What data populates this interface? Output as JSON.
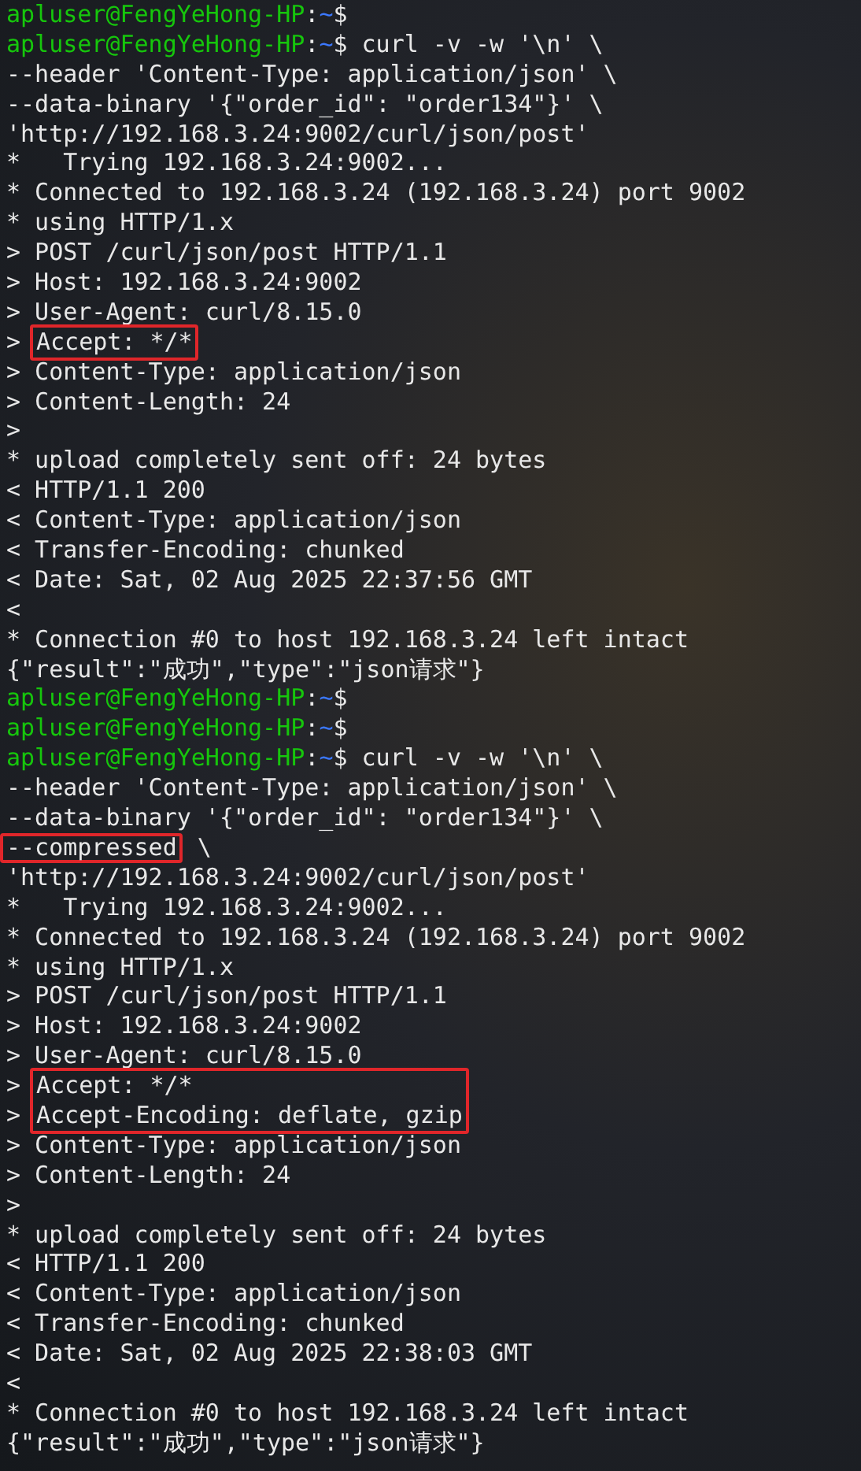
{
  "terminal": {
    "items": [
      {
        "kind": "line",
        "segments": [
          {
            "kind": "user",
            "text": "apluser@FengYeHong-HP"
          },
          {
            "kind": "text",
            "text": ":"
          },
          {
            "kind": "path",
            "text": "~"
          },
          {
            "kind": "text",
            "text": "$"
          }
        ]
      },
      {
        "kind": "line",
        "segments": [
          {
            "kind": "user",
            "text": "apluser@FengYeHong-HP"
          },
          {
            "kind": "text",
            "text": ":"
          },
          {
            "kind": "path",
            "text": "~"
          },
          {
            "kind": "text",
            "text": "$ curl -v -w '\\n' \\"
          }
        ]
      },
      {
        "kind": "line",
        "segments": [
          {
            "kind": "text",
            "text": "--header 'Content-Type: application/json' \\"
          }
        ]
      },
      {
        "kind": "line",
        "segments": [
          {
            "kind": "text",
            "text": "--data-binary '{\"order_id\": \"order134\"}' \\"
          }
        ]
      },
      {
        "kind": "line",
        "segments": [
          {
            "kind": "text",
            "text": "'http://192.168.3.24:9002/curl/json/post'"
          }
        ]
      },
      {
        "kind": "line",
        "segments": [
          {
            "kind": "text",
            "text": "*   Trying 192.168.3.24:9002..."
          }
        ]
      },
      {
        "kind": "line",
        "segments": [
          {
            "kind": "text",
            "text": "* Connected to 192.168.3.24 (192.168.3.24) port 9002"
          }
        ]
      },
      {
        "kind": "line",
        "segments": [
          {
            "kind": "text",
            "text": "* using HTTP/1.x"
          }
        ]
      },
      {
        "kind": "line",
        "segments": [
          {
            "kind": "text",
            "text": "> POST /curl/json/post HTTP/1.1"
          }
        ]
      },
      {
        "kind": "line",
        "segments": [
          {
            "kind": "text",
            "text": "> Host: 192.168.3.24:9002"
          }
        ]
      },
      {
        "kind": "line",
        "segments": [
          {
            "kind": "text",
            "text": "> User-Agent: curl/8.15.0"
          }
        ]
      },
      {
        "kind": "boxed-group",
        "rows": [
          {
            "prefix": ">",
            "text": "Accept: */*"
          }
        ]
      },
      {
        "kind": "line",
        "segments": [
          {
            "kind": "text",
            "text": "> Content-Type: application/json"
          }
        ]
      },
      {
        "kind": "line",
        "segments": [
          {
            "kind": "text",
            "text": "> Content-Length: 24"
          }
        ]
      },
      {
        "kind": "line",
        "segments": [
          {
            "kind": "text",
            "text": ">"
          }
        ]
      },
      {
        "kind": "line",
        "segments": [
          {
            "kind": "text",
            "text": "* upload completely sent off: 24 bytes"
          }
        ]
      },
      {
        "kind": "line",
        "segments": [
          {
            "kind": "text",
            "text": "< HTTP/1.1 200"
          }
        ]
      },
      {
        "kind": "line",
        "segments": [
          {
            "kind": "text",
            "text": "< Content-Type: application/json"
          }
        ]
      },
      {
        "kind": "line",
        "segments": [
          {
            "kind": "text",
            "text": "< Transfer-Encoding: chunked"
          }
        ]
      },
      {
        "kind": "line",
        "segments": [
          {
            "kind": "text",
            "text": "< Date: Sat, 02 Aug 2025 22:37:56 GMT"
          }
        ]
      },
      {
        "kind": "line",
        "segments": [
          {
            "kind": "text",
            "text": "<"
          }
        ]
      },
      {
        "kind": "line",
        "segments": [
          {
            "kind": "text",
            "text": "* Connection #0 to host 192.168.3.24 left intact"
          }
        ]
      },
      {
        "kind": "line",
        "segments": [
          {
            "kind": "text",
            "text": "{\"result\":\"成功\",\"type\":\"json请求\"}"
          }
        ]
      },
      {
        "kind": "line",
        "segments": [
          {
            "kind": "user",
            "text": "apluser@FengYeHong-HP"
          },
          {
            "kind": "text",
            "text": ":"
          },
          {
            "kind": "path",
            "text": "~"
          },
          {
            "kind": "text",
            "text": "$"
          }
        ]
      },
      {
        "kind": "line",
        "segments": [
          {
            "kind": "user",
            "text": "apluser@FengYeHong-HP"
          },
          {
            "kind": "text",
            "text": ":"
          },
          {
            "kind": "path",
            "text": "~"
          },
          {
            "kind": "text",
            "text": "$"
          }
        ]
      },
      {
        "kind": "line",
        "segments": [
          {
            "kind": "user",
            "text": "apluser@FengYeHong-HP"
          },
          {
            "kind": "text",
            "text": ":"
          },
          {
            "kind": "path",
            "text": "~"
          },
          {
            "kind": "text",
            "text": "$ curl -v -w '\\n' \\"
          }
        ]
      },
      {
        "kind": "line",
        "segments": [
          {
            "kind": "text",
            "text": "--header 'Content-Type: application/json' \\"
          }
        ]
      },
      {
        "kind": "line",
        "segments": [
          {
            "kind": "text",
            "text": "--data-binary '{\"order_id\": \"order134\"}' \\"
          }
        ]
      },
      {
        "kind": "line",
        "segments": [
          {
            "kind": "boxed",
            "text": "--compressed"
          },
          {
            "kind": "text",
            "text": " \\"
          }
        ]
      },
      {
        "kind": "line",
        "segments": [
          {
            "kind": "text",
            "text": "'http://192.168.3.24:9002/curl/json/post'"
          }
        ]
      },
      {
        "kind": "line",
        "segments": [
          {
            "kind": "text",
            "text": "*   Trying 192.168.3.24:9002..."
          }
        ]
      },
      {
        "kind": "line",
        "segments": [
          {
            "kind": "text",
            "text": "* Connected to 192.168.3.24 (192.168.3.24) port 9002"
          }
        ]
      },
      {
        "kind": "line",
        "segments": [
          {
            "kind": "text",
            "text": "* using HTTP/1.x"
          }
        ]
      },
      {
        "kind": "line",
        "segments": [
          {
            "kind": "text",
            "text": "> POST /curl/json/post HTTP/1.1"
          }
        ]
      },
      {
        "kind": "line",
        "segments": [
          {
            "kind": "text",
            "text": "> Host: 192.168.3.24:9002"
          }
        ]
      },
      {
        "kind": "line",
        "segments": [
          {
            "kind": "text",
            "text": "> User-Agent: curl/8.15.0"
          }
        ]
      },
      {
        "kind": "boxed-group",
        "rows": [
          {
            "prefix": ">",
            "text": "Accept: */*"
          },
          {
            "prefix": ">",
            "text": "Accept-Encoding: deflate, gzip"
          }
        ]
      },
      {
        "kind": "line",
        "segments": [
          {
            "kind": "text",
            "text": "> Content-Type: application/json"
          }
        ]
      },
      {
        "kind": "line",
        "segments": [
          {
            "kind": "text",
            "text": "> Content-Length: 24"
          }
        ]
      },
      {
        "kind": "line",
        "segments": [
          {
            "kind": "text",
            "text": ">"
          }
        ]
      },
      {
        "kind": "line",
        "segments": [
          {
            "kind": "text",
            "text": "* upload completely sent off: 24 bytes"
          }
        ]
      },
      {
        "kind": "line",
        "segments": [
          {
            "kind": "text",
            "text": "< HTTP/1.1 200"
          }
        ]
      },
      {
        "kind": "line",
        "segments": [
          {
            "kind": "text",
            "text": "< Content-Type: application/json"
          }
        ]
      },
      {
        "kind": "line",
        "segments": [
          {
            "kind": "text",
            "text": "< Transfer-Encoding: chunked"
          }
        ]
      },
      {
        "kind": "line",
        "segments": [
          {
            "kind": "text",
            "text": "< Date: Sat, 02 Aug 2025 22:38:03 GMT"
          }
        ]
      },
      {
        "kind": "line",
        "segments": [
          {
            "kind": "text",
            "text": "<"
          }
        ]
      },
      {
        "kind": "line",
        "segments": [
          {
            "kind": "text",
            "text": "* Connection #0 to host 192.168.3.24 left intact"
          }
        ]
      },
      {
        "kind": "line",
        "segments": [
          {
            "kind": "text",
            "text": "{\"result\":\"成功\",\"type\":\"json请求\"}"
          }
        ]
      }
    ]
  }
}
